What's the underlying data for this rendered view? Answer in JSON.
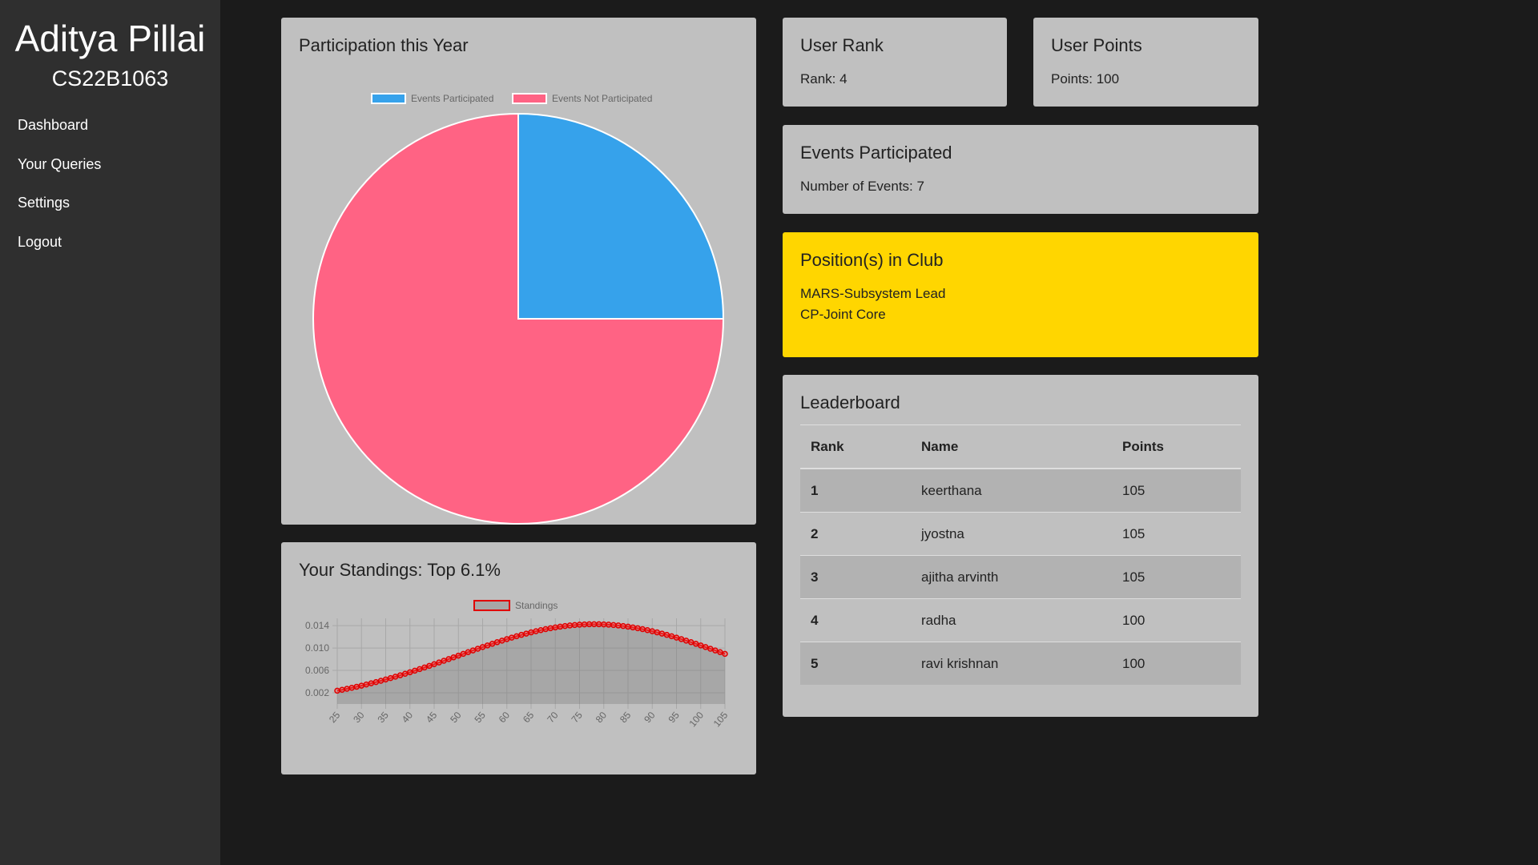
{
  "sidebar": {
    "user_name": "Aditya Pillai",
    "roll_number": "CS22B1063",
    "nav": [
      {
        "label": "Dashboard"
      },
      {
        "label": "Your Queries"
      },
      {
        "label": "Settings"
      },
      {
        "label": "Logout"
      }
    ]
  },
  "participation": {
    "title": "Participation this Year"
  },
  "standings": {
    "title": "Your Standings: Top 6.1%"
  },
  "user_rank": {
    "title": "User Rank",
    "text": "Rank: 4"
  },
  "user_points": {
    "title": "User Points",
    "text": "Points: 100"
  },
  "events": {
    "title": "Events Participated",
    "text": "Number of Events: 7"
  },
  "positions": {
    "title": "Position(s) in Club",
    "items": [
      "MARS-Subsystem Lead",
      "CP-Joint Core"
    ],
    "color": "#ffd600"
  },
  "leaderboard": {
    "title": "Leaderboard",
    "headers": [
      "Rank",
      "Name",
      "Points"
    ],
    "rows": [
      {
        "rank": "1",
        "name": "keerthana",
        "points": "105"
      },
      {
        "rank": "2",
        "name": "jyostna",
        "points": "105"
      },
      {
        "rank": "3",
        "name": "ajitha arvinth",
        "points": "105"
      },
      {
        "rank": "4",
        "name": "radha",
        "points": "100"
      },
      {
        "rank": "5",
        "name": "ravi krishnan",
        "points": "100"
      }
    ]
  },
  "chart_data": [
    {
      "type": "pie",
      "title": "",
      "categories": [
        "Events Participated",
        "Events Not Participated"
      ],
      "values": [
        7,
        21
      ],
      "colors": [
        "#36a2eb",
        "#ff6384"
      ],
      "legend": "top"
    },
    {
      "type": "area",
      "title": "",
      "series": [
        {
          "name": "Standings",
          "color": "#e00000",
          "fill": "rgba(120,120,120,0.35)"
        }
      ],
      "distribution": {
        "kind": "normal",
        "mean": 78,
        "sd": 28
      },
      "x_range": [
        25,
        105
      ],
      "x_step": 1,
      "x_ticks": [
        "25",
        "30",
        "35",
        "40",
        "45",
        "50",
        "55",
        "60",
        "65",
        "70",
        "75",
        "80",
        "85",
        "90",
        "95",
        "100",
        "105"
      ],
      "y_ticks": [
        "0.002",
        "0.006",
        "0.010",
        "0.014"
      ],
      "ylim": [
        0,
        0.0153
      ],
      "grid": true,
      "legend": "top"
    }
  ]
}
